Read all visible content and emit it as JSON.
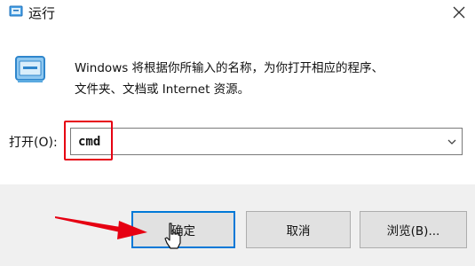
{
  "window": {
    "title": "运行",
    "app_icon": "run-app-icon",
    "close_icon": "close-icon"
  },
  "content": {
    "icon": "run-dialog-icon",
    "description_line1": "Windows 将根据你所输入的名称，为你打开相应的程序、",
    "description_line2": "文件夹、文档或 Internet 资源。"
  },
  "open_field": {
    "label": "打开(O):",
    "value": "cmd",
    "dropdown_icon": "chevron-down-icon"
  },
  "buttons": {
    "ok": "确定",
    "cancel": "取消",
    "browse": "浏览(B)..."
  },
  "annotations": {
    "highlight_color": "#e60012",
    "arrow_color": "#e60012"
  },
  "colors": {
    "footer_bg": "#f0f0f0",
    "default_button_border": "#0078d7"
  }
}
